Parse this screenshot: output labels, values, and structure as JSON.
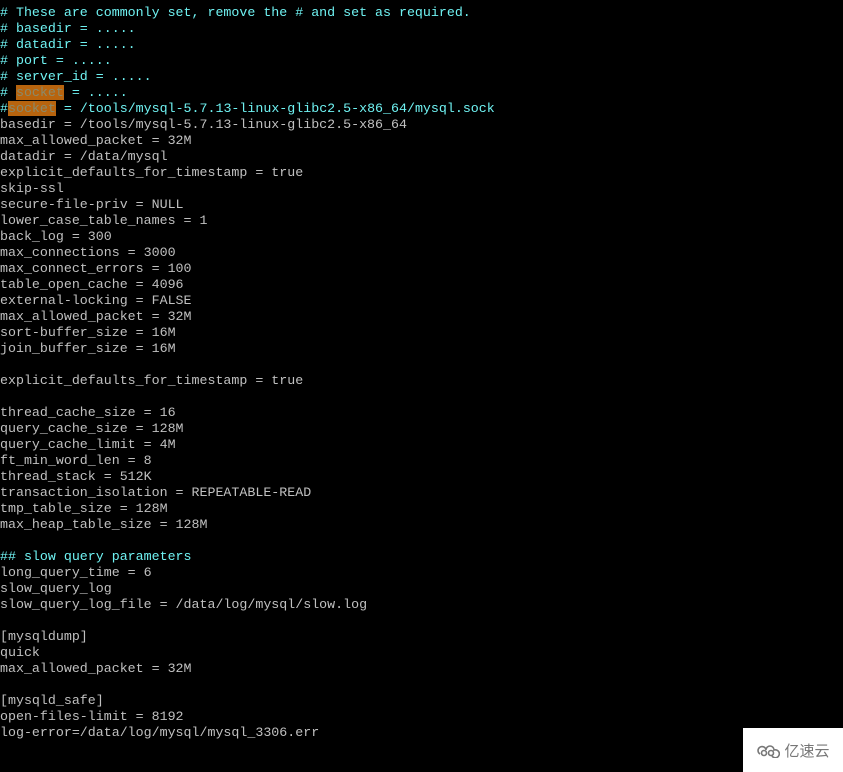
{
  "terminal": {
    "lines": [
      {
        "type": "comment",
        "text": "# These are commonly set, remove the # and set as required."
      },
      {
        "type": "comment",
        "text": "# basedir = ....."
      },
      {
        "type": "comment",
        "text": "# datadir = ....."
      },
      {
        "type": "comment",
        "text": "# port = ....."
      },
      {
        "type": "comment",
        "text": "# server_id = ....."
      },
      {
        "type": "highlight",
        "prefix": "# ",
        "match": "socket",
        "suffix": " = ....."
      },
      {
        "type": "highlight",
        "prefix": "#",
        "match": "socket",
        "suffix": " = /tools/mysql-5.7.13-linux-glibc2.5-x86_64/mysql.sock"
      },
      {
        "type": "plain",
        "text": "basedir = /tools/mysql-5.7.13-linux-glibc2.5-x86_64"
      },
      {
        "type": "plain",
        "text": "max_allowed_packet = 32M"
      },
      {
        "type": "plain",
        "text": "datadir = /data/mysql"
      },
      {
        "type": "plain",
        "text": "explicit_defaults_for_timestamp = true"
      },
      {
        "type": "plain",
        "text": "skip-ssl"
      },
      {
        "type": "plain",
        "text": "secure-file-priv = NULL"
      },
      {
        "type": "plain",
        "text": "lower_case_table_names = 1"
      },
      {
        "type": "plain",
        "text": "back_log = 300"
      },
      {
        "type": "plain",
        "text": "max_connections = 3000"
      },
      {
        "type": "plain",
        "text": "max_connect_errors = 100"
      },
      {
        "type": "plain",
        "text": "table_open_cache = 4096"
      },
      {
        "type": "plain",
        "text": "external-locking = FALSE"
      },
      {
        "type": "plain",
        "text": "max_allowed_packet = 32M"
      },
      {
        "type": "plain",
        "text": "sort-buffer_size = 16M"
      },
      {
        "type": "plain",
        "text": "join_buffer_size = 16M"
      },
      {
        "type": "plain",
        "text": ""
      },
      {
        "type": "plain",
        "text": "explicit_defaults_for_timestamp = true"
      },
      {
        "type": "plain",
        "text": ""
      },
      {
        "type": "plain",
        "text": "thread_cache_size = 16"
      },
      {
        "type": "plain",
        "text": "query_cache_size = 128M"
      },
      {
        "type": "plain",
        "text": "query_cache_limit = 4M"
      },
      {
        "type": "plain",
        "text": "ft_min_word_len = 8"
      },
      {
        "type": "plain",
        "text": "thread_stack = 512K"
      },
      {
        "type": "plain",
        "text": "transaction_isolation = REPEATABLE-READ"
      },
      {
        "type": "plain",
        "text": "tmp_table_size = 128M"
      },
      {
        "type": "plain",
        "text": "max_heap_table_size = 128M"
      },
      {
        "type": "plain",
        "text": ""
      },
      {
        "type": "comment",
        "text": "## slow query parameters"
      },
      {
        "type": "plain",
        "text": "long_query_time = 6"
      },
      {
        "type": "plain",
        "text": "slow_query_log"
      },
      {
        "type": "plain",
        "text": "slow_query_log_file = /data/log/mysql/slow.log"
      },
      {
        "type": "plain",
        "text": ""
      },
      {
        "type": "plain",
        "text": "[mysqldump]"
      },
      {
        "type": "plain",
        "text": "quick"
      },
      {
        "type": "plain",
        "text": "max_allowed_packet = 32M"
      },
      {
        "type": "plain",
        "text": ""
      },
      {
        "type": "plain",
        "text": "[mysqld_safe]"
      },
      {
        "type": "plain",
        "text": "open-files-limit = 8192"
      },
      {
        "type": "plain",
        "text": "log-error=/data/log/mysql/mysql_3306.err"
      }
    ]
  },
  "watermark": {
    "icon": "cloud-logo-icon",
    "text": "亿速云"
  },
  "colors": {
    "background": "#000000",
    "text": "#c0c0c0",
    "comment": "#6ff2f2",
    "highlight": "#b8640e"
  }
}
